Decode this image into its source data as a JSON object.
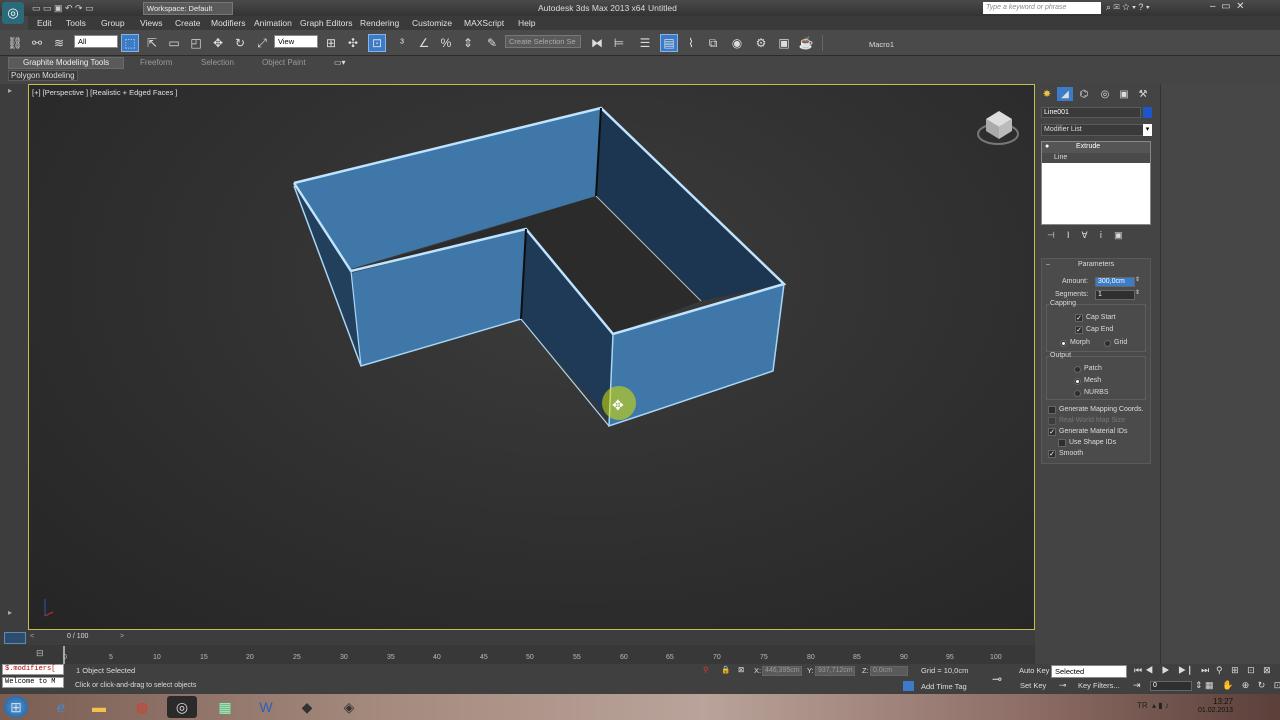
{
  "title_bar": {
    "workspace": "Workspace: Default",
    "app_title": "Autodesk 3ds Max 2013 x64",
    "doc_title": "Untitled",
    "search_placeholder": "Type a keyword or phrase"
  },
  "menu": [
    "Edit",
    "Tools",
    "Group",
    "Views",
    "Create",
    "Modifiers",
    "Animation",
    "Graph Editors",
    "Rendering",
    "Customize",
    "MAXScript",
    "Help"
  ],
  "toolbar": {
    "selection_filter": "All",
    "ref_coord": "View",
    "named_sel": "Create Selection Se",
    "macro": "Macro1"
  },
  "ribbon": {
    "tabs": [
      "Graphite Modeling Tools",
      "Freeform",
      "Selection",
      "Object Paint"
    ],
    "sub": "Polygon Modeling"
  },
  "viewport": {
    "label": "[+] [Perspective ] [Realistic + Edged Faces ]"
  },
  "command_panel": {
    "object_name": "Line001",
    "modifier_list": "Modifier List",
    "stack": [
      "Extrude",
      "Line"
    ],
    "params_title": "Parameters",
    "amount_label": "Amount:",
    "amount_value": "300,0cm",
    "segments_label": "Segments:",
    "segments_value": "1",
    "capping_label": "Capping",
    "cap_start": "Cap Start",
    "cap_end": "Cap End",
    "morph": "Morph",
    "grid": "Grid",
    "output_label": "Output",
    "patch": "Patch",
    "mesh": "Mesh",
    "nurbs": "NURBS",
    "gen_map": "Generate Mapping Coords.",
    "real_world": "Real-World Map Size",
    "gen_mat": "Generate Material IDs",
    "use_shape": "Use Shape IDs",
    "smooth": "Smooth"
  },
  "timeline": {
    "frame": "0 / 100",
    "ticks": [
      "0",
      "5",
      "10",
      "15",
      "20",
      "25",
      "30",
      "35",
      "40",
      "45",
      "50",
      "55",
      "60",
      "65",
      "70",
      "75",
      "80",
      "85",
      "90",
      "95",
      "100"
    ]
  },
  "status": {
    "maxscript": "$.modifiers[",
    "welcome": "Welcome to M",
    "selected": "1 Object Selected",
    "prompt": "Click or click-and-drag to select objects",
    "x_label": "X:",
    "x_val": "446,395cm",
    "y_label": "Y:",
    "y_val": "937,712cm",
    "z_label": "Z:",
    "z_val": "0,0cm",
    "grid": "Grid = 10,0cm",
    "add_time_tag": "Add Time Tag",
    "auto_key": "Auto Key",
    "set_key": "Set Key",
    "selected_dd": "Selected",
    "key_filters": "Key Filters...",
    "frame_field": "0"
  },
  "taskbar": {
    "lang": "TR",
    "time": "13:27",
    "date": "01.02.2013"
  },
  "colors": {
    "object_blue": "#3f78a8",
    "viewport_border": "#c8bc4a",
    "selection_blue": "#3b7bc8"
  }
}
